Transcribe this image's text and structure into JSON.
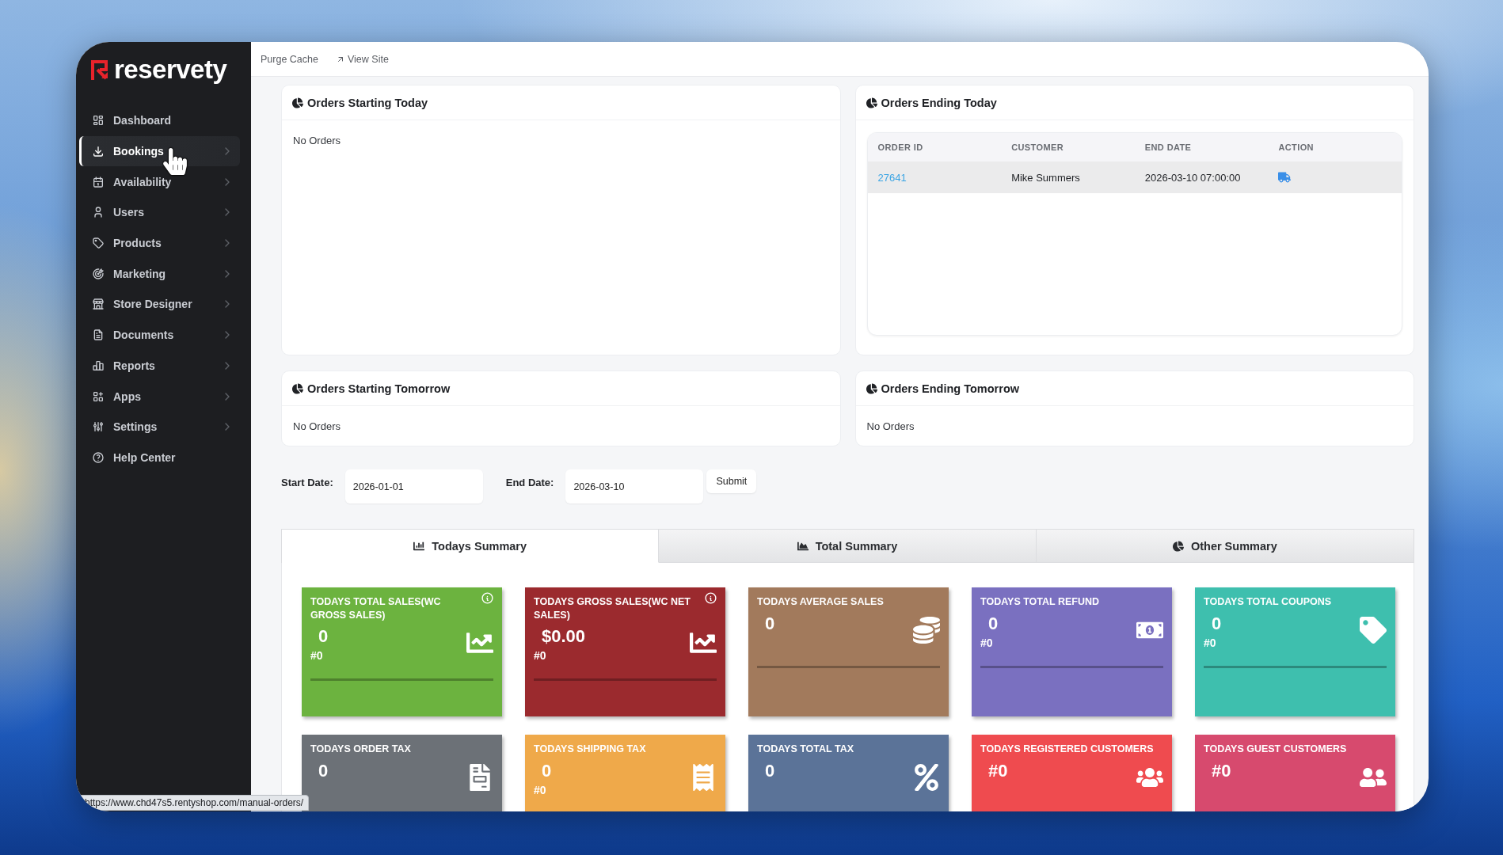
{
  "sidebar": {
    "logo": "reservety",
    "items": [
      {
        "label": "Dashboard",
        "kind": "link",
        "selected": false
      },
      {
        "label": "Bookings",
        "kind": "group",
        "selected": true
      },
      {
        "label": "Availability",
        "kind": "group",
        "selected": false
      },
      {
        "label": "Users",
        "kind": "group",
        "selected": false
      },
      {
        "label": "Products",
        "kind": "group",
        "selected": false
      },
      {
        "label": "Marketing",
        "kind": "group",
        "selected": false
      },
      {
        "label": "Store Designer",
        "kind": "group",
        "selected": false
      },
      {
        "label": "Documents",
        "kind": "group",
        "selected": false
      },
      {
        "label": "Reports",
        "kind": "group",
        "selected": false
      },
      {
        "label": "Apps",
        "kind": "group",
        "selected": false
      },
      {
        "label": "Settings",
        "kind": "group",
        "selected": false
      },
      {
        "label": "Help Center",
        "kind": "link",
        "selected": false
      }
    ]
  },
  "top_bar": {
    "links": [
      {
        "label": "Purge Cache",
        "kind": "action"
      },
      {
        "label": "View Site",
        "kind": "external"
      }
    ]
  },
  "panels": [
    {
      "title": "Orders Starting Today",
      "kind": "empty",
      "message": "No Orders"
    },
    {
      "title": "Orders Ending Today",
      "kind": "table",
      "table": {
        "columns": [
          "ORDER ID",
          "CUSTOMER",
          "END DATE",
          "ACTION"
        ],
        "rows": [
          {
            "order_id": "27641",
            "customer": "Mike Summers",
            "end_date": "2026-03-10 07:00:00"
          }
        ]
      }
    },
    {
      "title": "Orders Starting Tomorrow",
      "kind": "empty",
      "message": "No Orders"
    },
    {
      "title": "Orders Ending Tomorrow",
      "kind": "empty",
      "message": "No Orders"
    }
  ],
  "date_filter": {
    "start": {
      "label": "Start Date:",
      "value": "2026-01-01"
    },
    "end": {
      "label": "End Date:",
      "value": "2026-03-10"
    },
    "submit": "Submit"
  },
  "summary_tabs": [
    {
      "label": "Todays Summary",
      "kind": "bar",
      "selected": true
    },
    {
      "label": "Total Summary",
      "kind": "area",
      "selected": false
    },
    {
      "label": "Other Summary",
      "kind": "pie",
      "selected": false
    }
  ],
  "stat_cards": [
    {
      "title": "TODAYS TOTAL SALES(WC GROSS SALES)",
      "value": "0",
      "count": "#0",
      "kind": "chart",
      "info": true,
      "color": "#6cb33f"
    },
    {
      "title": "TODAYS GROSS SALES(WC NET SALES)",
      "value": "$0.00",
      "count": "#0",
      "kind": "chart",
      "info": true,
      "color": "#9b2a2e"
    },
    {
      "title": "TODAYS AVERAGE SALES",
      "value": "0",
      "kind": "coin",
      "info": false,
      "color": "#a27a5c"
    },
    {
      "title": "TODAYS TOTAL REFUND",
      "value": "0",
      "count": "#0",
      "kind": "cash",
      "info": false,
      "color": "#7a70c0"
    },
    {
      "title": "TODAYS TOTAL COUPONS",
      "value": "0",
      "count": "#0",
      "kind": "tag",
      "info": false,
      "color": "#3ebfae"
    },
    {
      "title": "TODAYS ORDER TAX",
      "value": "0",
      "kind": "taxdoc",
      "info": false,
      "color": "#6c7177"
    },
    {
      "title": "TODAYS SHIPPING TAX",
      "value": "0",
      "count": "#0",
      "kind": "taxticket",
      "info": false,
      "color": "#efa94a"
    },
    {
      "title": "TODAYS TOTAL TAX",
      "value": "0",
      "kind": "percent",
      "info": false,
      "color": "#5b7398"
    },
    {
      "title": "TODAYS REGISTERED CUSTOMERS",
      "value": "#0",
      "kind": "user",
      "info": false,
      "color": "#ef4b4f"
    },
    {
      "title": "TODAYS GUEST CUSTOMERS",
      "value": "#0",
      "kind": "group",
      "info": false,
      "color": "#d74a6e"
    }
  ],
  "status_url": "https://www.chd47s5.rentyshop.com/manual-orders/"
}
